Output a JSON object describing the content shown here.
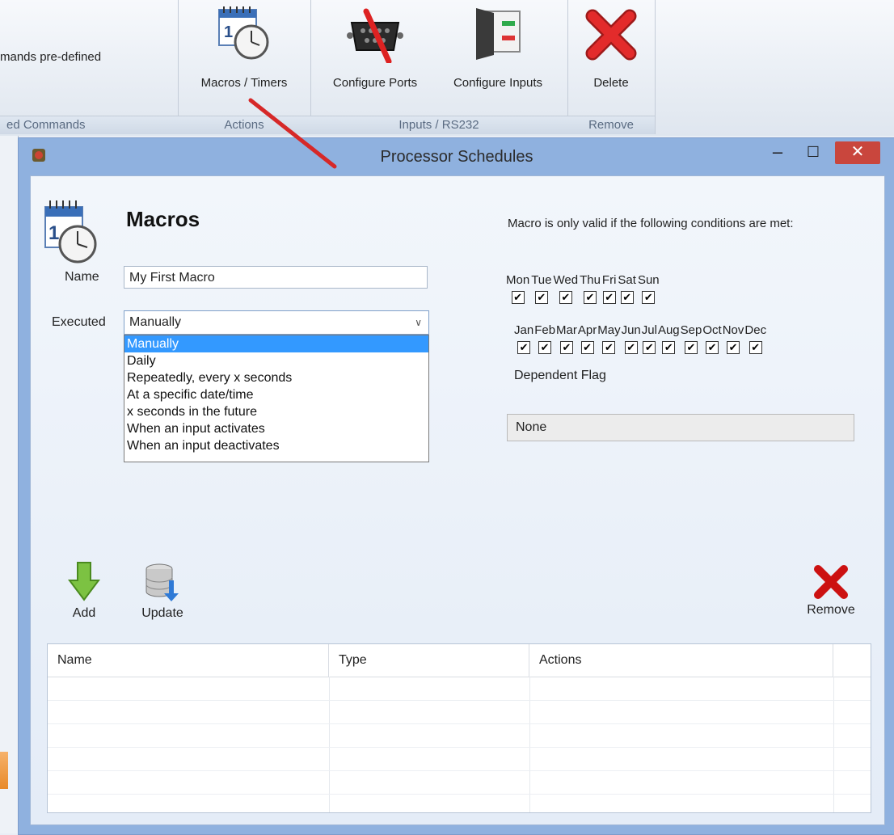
{
  "ribbon": {
    "partial_group": {
      "button_text": "mands pre-defined",
      "group_label": "ed Commands"
    },
    "actions_group": {
      "label": "Actions",
      "macros_timers": "Macros / Timers"
    },
    "inputs_group": {
      "label": "Inputs / RS232",
      "configure_ports": "Configure Ports",
      "configure_inputs": "Configure Inputs"
    },
    "remove_group": {
      "label": "Remove",
      "delete": "Delete"
    }
  },
  "window": {
    "title": "Processor Schedules",
    "minimize": "–",
    "maximize": "☐",
    "close": "✕"
  },
  "macros": {
    "heading": "Macros",
    "name_label": "Name",
    "name_value": "My First Macro",
    "executed_label": "Executed",
    "executed_value": "Manually",
    "executed_options": [
      "Manually",
      "Daily",
      "Repeatedly, every x seconds",
      "At a specific date/time",
      "x seconds in the future",
      "When an input activates",
      "When an input deactivates"
    ]
  },
  "conditions": {
    "title": "Macro is only valid if the following conditions are met:",
    "days": [
      "Mon",
      "Tue",
      "Wed",
      "Thu",
      "Fri",
      "Sat",
      "Sun"
    ],
    "months": [
      "Jan",
      "Feb",
      "Mar",
      "Apr",
      "May",
      "Jun",
      "Jul",
      "Aug",
      "Sep",
      "Oct",
      "Nov",
      "Dec"
    ],
    "dependent_flag_label": "Dependent Flag",
    "dependent_flag_value": "None"
  },
  "toolbar": {
    "add": "Add",
    "update": "Update",
    "remove": "Remove"
  },
  "grid": {
    "columns": [
      "Name",
      "Type",
      "Actions"
    ]
  }
}
